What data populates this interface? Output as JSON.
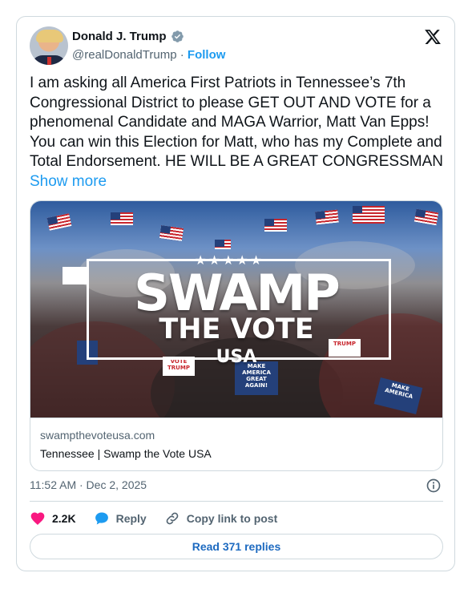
{
  "author": {
    "name": "Donald J. Trump",
    "handle": "@realDonaldTrump",
    "separator": "·",
    "follow_label": "Follow"
  },
  "post": {
    "text": "I am asking all America First Patriots in Tennessee’s 7th Congressional District to please GET OUT AND VOTE for a phenomenal Candidate and MAGA Warrior, Matt Van Epps! You can win this Election for Matt, who has my Complete and Total Endorsement. HE WILL BE A GREAT CONGRESSMAN",
    "show_more": "Show more"
  },
  "media": {
    "stars": "★★★★★",
    "line1": "SWAMP",
    "line2": "THE VOTE",
    "line3": "USA",
    "sign1": "MAKE AMERICA GREAT AGAIN!",
    "sign2": "VOTE TRUMP",
    "sign3": "TRUMP",
    "sign4": "MAKE AMERICA",
    "domain": "swampthevoteusa.com",
    "title": "Tennessee | Swamp the Vote USA"
  },
  "meta": {
    "timestamp": "11:52 AM · Dec 2, 2025"
  },
  "actions": {
    "likes": "2.2K",
    "reply": "Reply",
    "copy_link": "Copy link to post",
    "read_replies": "Read 371 replies"
  },
  "icons": {
    "like": "heart-icon",
    "reply": "speech-bubble-icon",
    "copy": "link-icon",
    "info": "info-icon",
    "brand": "x-logo-icon",
    "verified": "verified-badge-icon"
  },
  "colors": {
    "accent": "#1d9bf0",
    "heart": "#f91880",
    "muted": "#536471",
    "border": "#cfd9de"
  }
}
